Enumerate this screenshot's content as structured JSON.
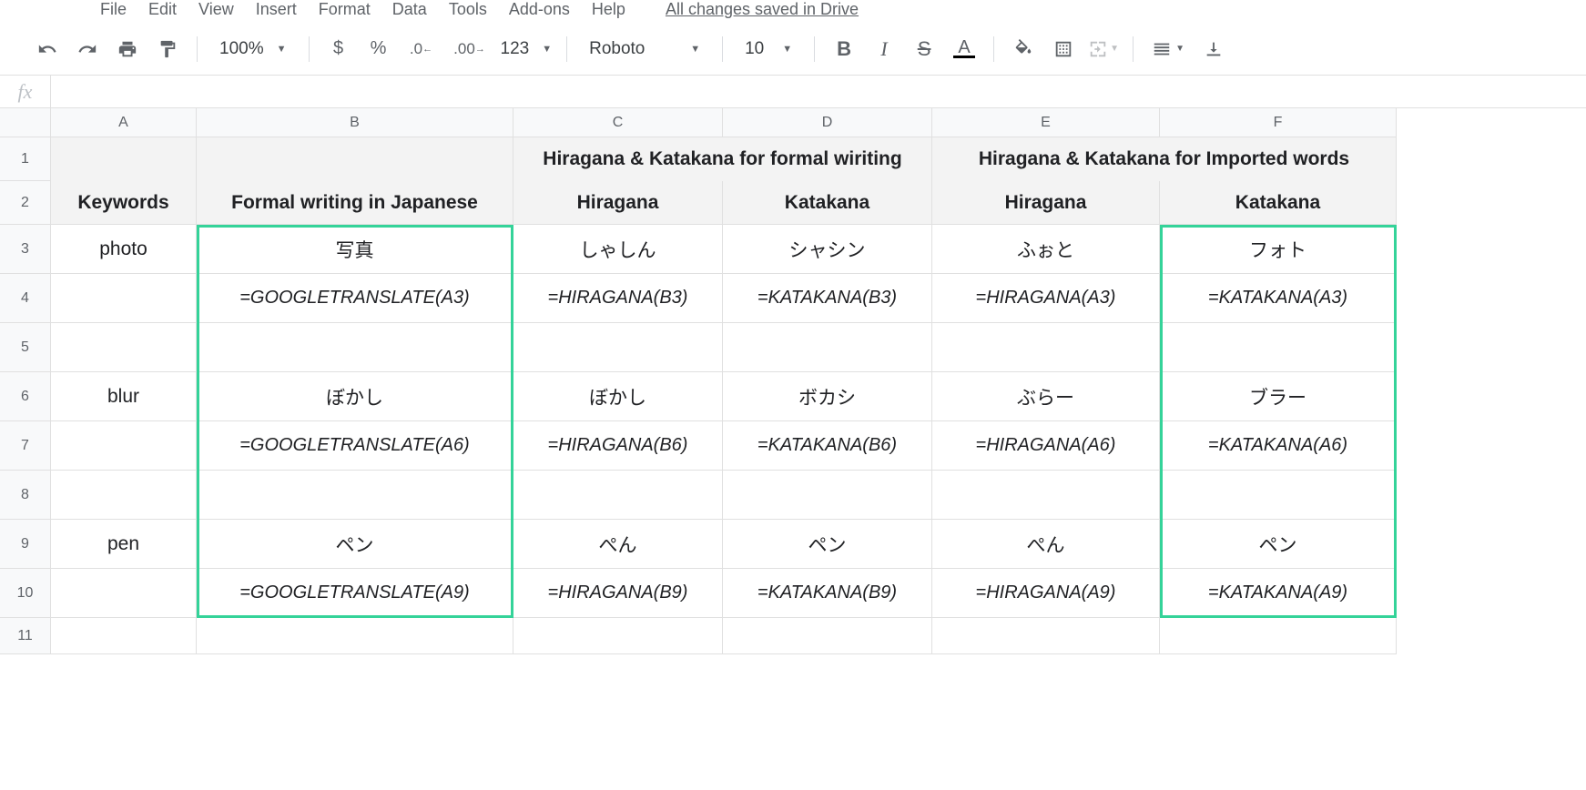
{
  "menubar": {
    "items": [
      "File",
      "Edit",
      "View",
      "Insert",
      "Format",
      "Data",
      "Tools",
      "Add-ons",
      "Help"
    ],
    "saved": "All changes saved in Drive"
  },
  "toolbar": {
    "zoom": "100%",
    "font": "Roboto",
    "fontSize": "10",
    "currency": "$",
    "percent": "%",
    "decDecrease": ".0",
    "decIncrease": ".00",
    "more123": "123"
  },
  "fx": {
    "value": ""
  },
  "columns": [
    "A",
    "B",
    "C",
    "D",
    "E",
    "F"
  ],
  "rowNumbers": [
    "1",
    "2",
    "3",
    "4",
    "5",
    "6",
    "7",
    "8",
    "9",
    "10",
    "11"
  ],
  "headers": {
    "keywords": "Keywords",
    "formal": "Formal writing in Japanese",
    "hk_formal": "Hiragana & Katakana for formal wiriting",
    "hk_imported": "Hiragana & Katakana for Imported words",
    "hiragana": "Hiragana",
    "katakana": "Katakana"
  },
  "rows": [
    {
      "keyword": "photo",
      "B": "写真",
      "Bf": "=GOOGLETRANSLATE(A3)",
      "C": "しゃしん",
      "Cf": "=HIRAGANA(B3)",
      "D": "シャシン",
      "Df": "=KATAKANA(B3)",
      "E": "ふぉと",
      "Ef": "=HIRAGANA(A3)",
      "F": "フォト",
      "Ff": "=KATAKANA(A3)"
    },
    {
      "keyword": "blur",
      "B": "ぼかし",
      "Bf": "=GOOGLETRANSLATE(A6)",
      "C": "ぼかし",
      "Cf": "=HIRAGANA(B6)",
      "D": "ボカシ",
      "Df": "=KATAKANA(B6)",
      "E": "ぶらー",
      "Ef": "=HIRAGANA(A6)",
      "F": "ブラー",
      "Ff": "=KATAKANA(A6)"
    },
    {
      "keyword": "pen",
      "B": "ペン",
      "Bf": "=GOOGLETRANSLATE(A9)",
      "C": "ぺん",
      "Cf": "=HIRAGANA(B9)",
      "D": "ペン",
      "Df": "=KATAKANA(B9)",
      "E": "ぺん",
      "Ef": "=HIRAGANA(A9)",
      "F": "ペン",
      "Ff": "=KATAKANA(A9)"
    }
  ]
}
